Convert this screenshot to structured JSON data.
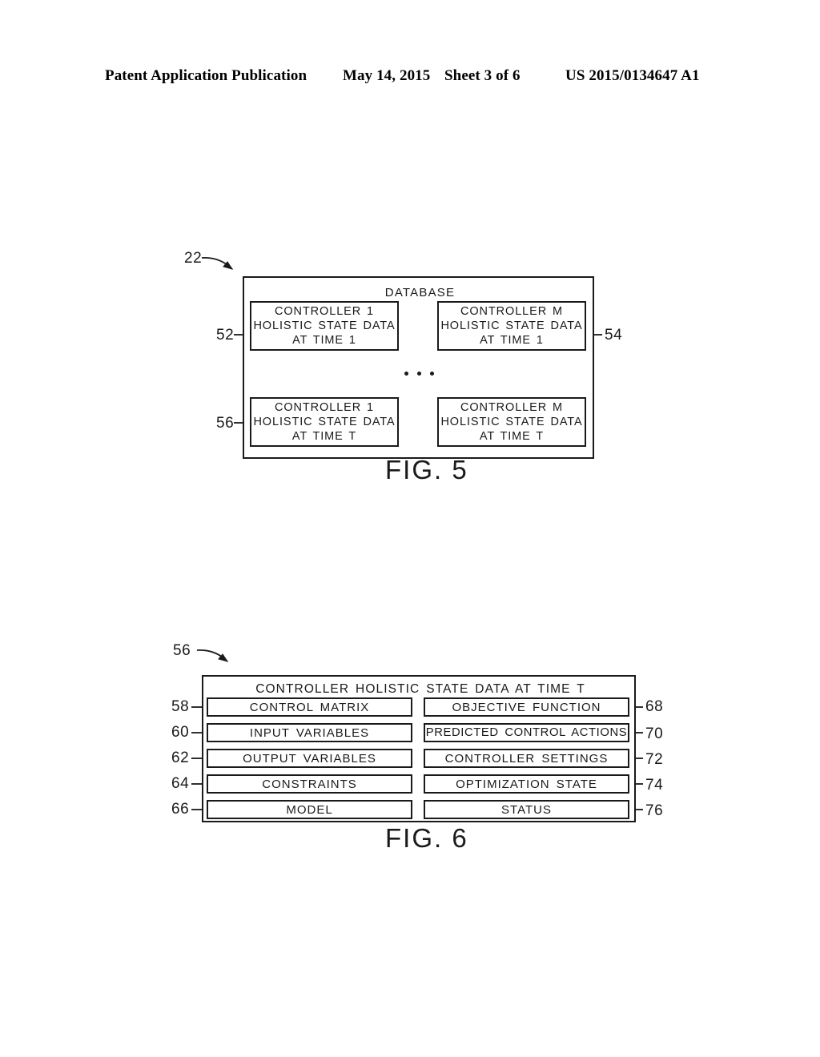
{
  "header": {
    "publication": "Patent Application Publication",
    "date": "May 14, 2015",
    "sheet": "Sheet 3 of 6",
    "patent_number": "US 2015/0134647 A1"
  },
  "figure5": {
    "caption": "FIG. 5",
    "ref_assembly": "22",
    "container_label": "DATABASE",
    "ellipsis": "•••",
    "cells": [
      {
        "ref": "52",
        "ref_side": "left",
        "line1": "CONTROLLER 1",
        "line2": "HOLISTIC STATE DATA",
        "line3": "AT TIME 1"
      },
      {
        "ref": "54",
        "ref_side": "right",
        "line1": "CONTROLLER M",
        "line2": "HOLISTIC STATE DATA",
        "line3": "AT TIME 1"
      },
      {
        "ref": "56",
        "ref_side": "left",
        "line1": "CONTROLLER 1",
        "line2": "HOLISTIC STATE DATA",
        "line3": "AT TIME T"
      },
      {
        "ref": "",
        "ref_side": "none",
        "line1": "CONTROLLER M",
        "line2": "HOLISTIC STATE DATA",
        "line3": "AT TIME T"
      }
    ]
  },
  "figure6": {
    "caption": "FIG. 6",
    "ref_assembly": "56",
    "header_label": "CONTROLLER HOLISTIC STATE DATA AT TIME T",
    "left_column": [
      {
        "ref": "58",
        "label": "CONTROL MATRIX"
      },
      {
        "ref": "60",
        "label": "INPUT VARIABLES"
      },
      {
        "ref": "62",
        "label": "OUTPUT VARIABLES"
      },
      {
        "ref": "64",
        "label": "CONSTRAINTS"
      },
      {
        "ref": "66",
        "label": "MODEL"
      }
    ],
    "right_column": [
      {
        "ref": "68",
        "label": "OBJECTIVE FUNCTION"
      },
      {
        "ref": "70",
        "label": "PREDICTED CONTROL ACTIONS"
      },
      {
        "ref": "72",
        "label": "CONTROLLER SETTINGS"
      },
      {
        "ref": "74",
        "label": "OPTIMIZATION STATE"
      },
      {
        "ref": "76",
        "label": "STATUS"
      }
    ]
  },
  "colors": {
    "ink": "#1a1a1a",
    "paper": "#ffffff"
  }
}
